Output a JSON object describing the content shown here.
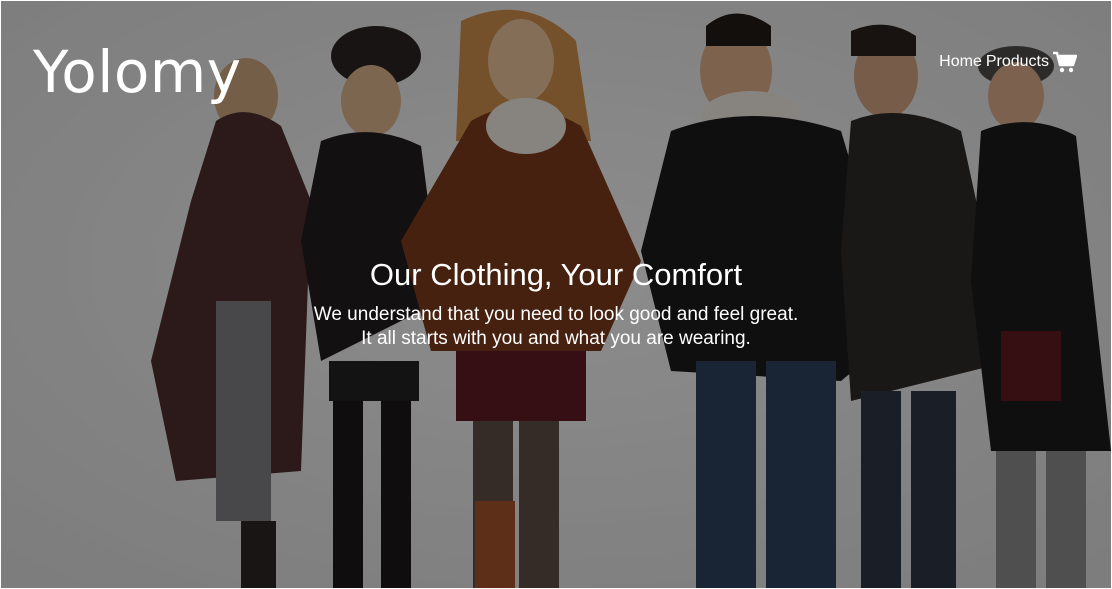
{
  "brand": {
    "name": "Yolomy"
  },
  "nav": {
    "items": [
      {
        "label": "Home"
      },
      {
        "label": "Products"
      }
    ],
    "cart_icon": "shopping-cart-icon"
  },
  "hero": {
    "headline": "Our Clothing, Your Comfort",
    "tagline": [
      "We understand that you need to look good and feel great.",
      "It all starts with you and what you are wearing."
    ],
    "image_icon": "winter-models-photo"
  },
  "colors": {
    "text": "#ffffff",
    "overlay": "#000000"
  }
}
